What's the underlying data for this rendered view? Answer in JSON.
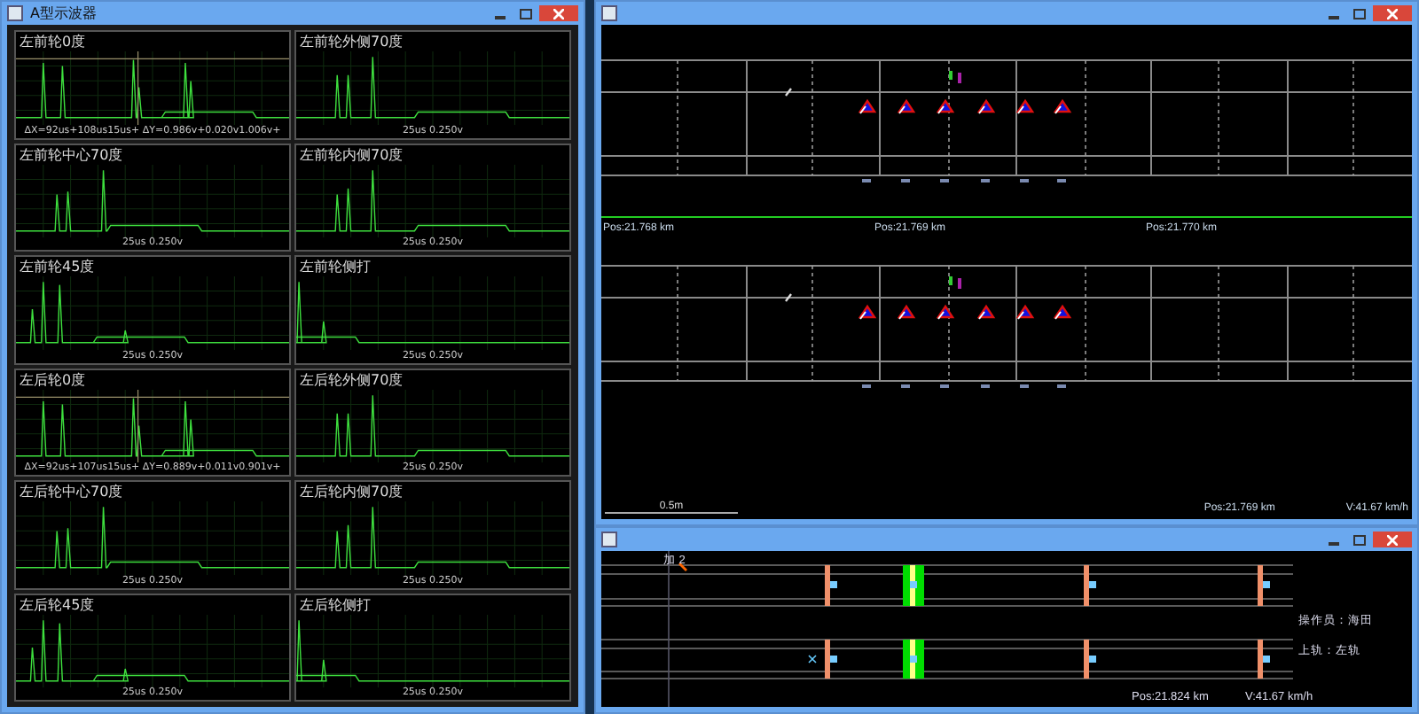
{
  "scope_window": {
    "title": "A型示波器",
    "panels": [
      {
        "title": "左前轮0度",
        "kind": "cursor",
        "readout": "ΔX=92us+108us15us+  ΔY=0.986v+0.020v1.006v+"
      },
      {
        "title": "左前轮外侧70度",
        "kind": "plain",
        "readout": "25us  0.250v"
      },
      {
        "title": "左前轮中心70度",
        "kind": "plain",
        "readout": "25us  0.250v"
      },
      {
        "title": "左前轮内侧70度",
        "kind": "plain",
        "readout": "25us  0.250v"
      },
      {
        "title": "左前轮45度",
        "kind": "plain",
        "readout": "25us  0.250v"
      },
      {
        "title": "左前轮侧打",
        "kind": "plain",
        "readout": "25us  0.250v"
      },
      {
        "title": "左后轮0度",
        "kind": "cursor",
        "readout": "ΔX=92us+107us15us+  ΔY=0.889v+0.011v0.901v+"
      },
      {
        "title": "左后轮外侧70度",
        "kind": "plain",
        "readout": "25us  0.250v"
      },
      {
        "title": "左后轮中心70度",
        "kind": "plain",
        "readout": "25us  0.250v"
      },
      {
        "title": "左后轮内侧70度",
        "kind": "plain",
        "readout": "25us  0.250v"
      },
      {
        "title": "左后轮45度",
        "kind": "plain",
        "readout": "25us  0.250v"
      },
      {
        "title": "左后轮侧打",
        "kind": "plain",
        "readout": "25us  0.250v"
      }
    ]
  },
  "scan_window": {
    "positions": [
      "Pos:21.768 km",
      "Pos:21.769 km",
      "Pos:21.770 km"
    ],
    "scale": "0.5m",
    "position": "Pos:21.769 km",
    "speed": "V:41.67 km/h"
  },
  "rail_window": {
    "marker": "加 2",
    "operator": "操作员：海田",
    "rail": "上轨：左轨",
    "position": "Pos:21.824 km",
    "speed": "V:41.67 km/h"
  }
}
